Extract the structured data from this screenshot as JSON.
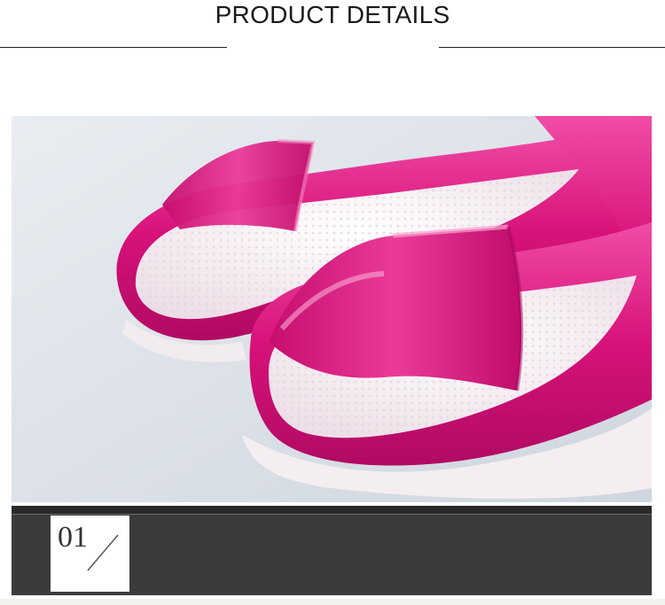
{
  "header": {
    "title": "PRODUCT DETAILS"
  },
  "product_image": {
    "subject": "pink jelly peep-toe sandals",
    "colors": {
      "strap": "#d8127a",
      "strap_highlight": "#f062b0",
      "footbed": "#f5eef2",
      "background": "#dfe5ec"
    }
  },
  "detail_band": {
    "number": "01",
    "colors": {
      "band": "#3b3b3b",
      "badge": "#ffffff"
    }
  }
}
